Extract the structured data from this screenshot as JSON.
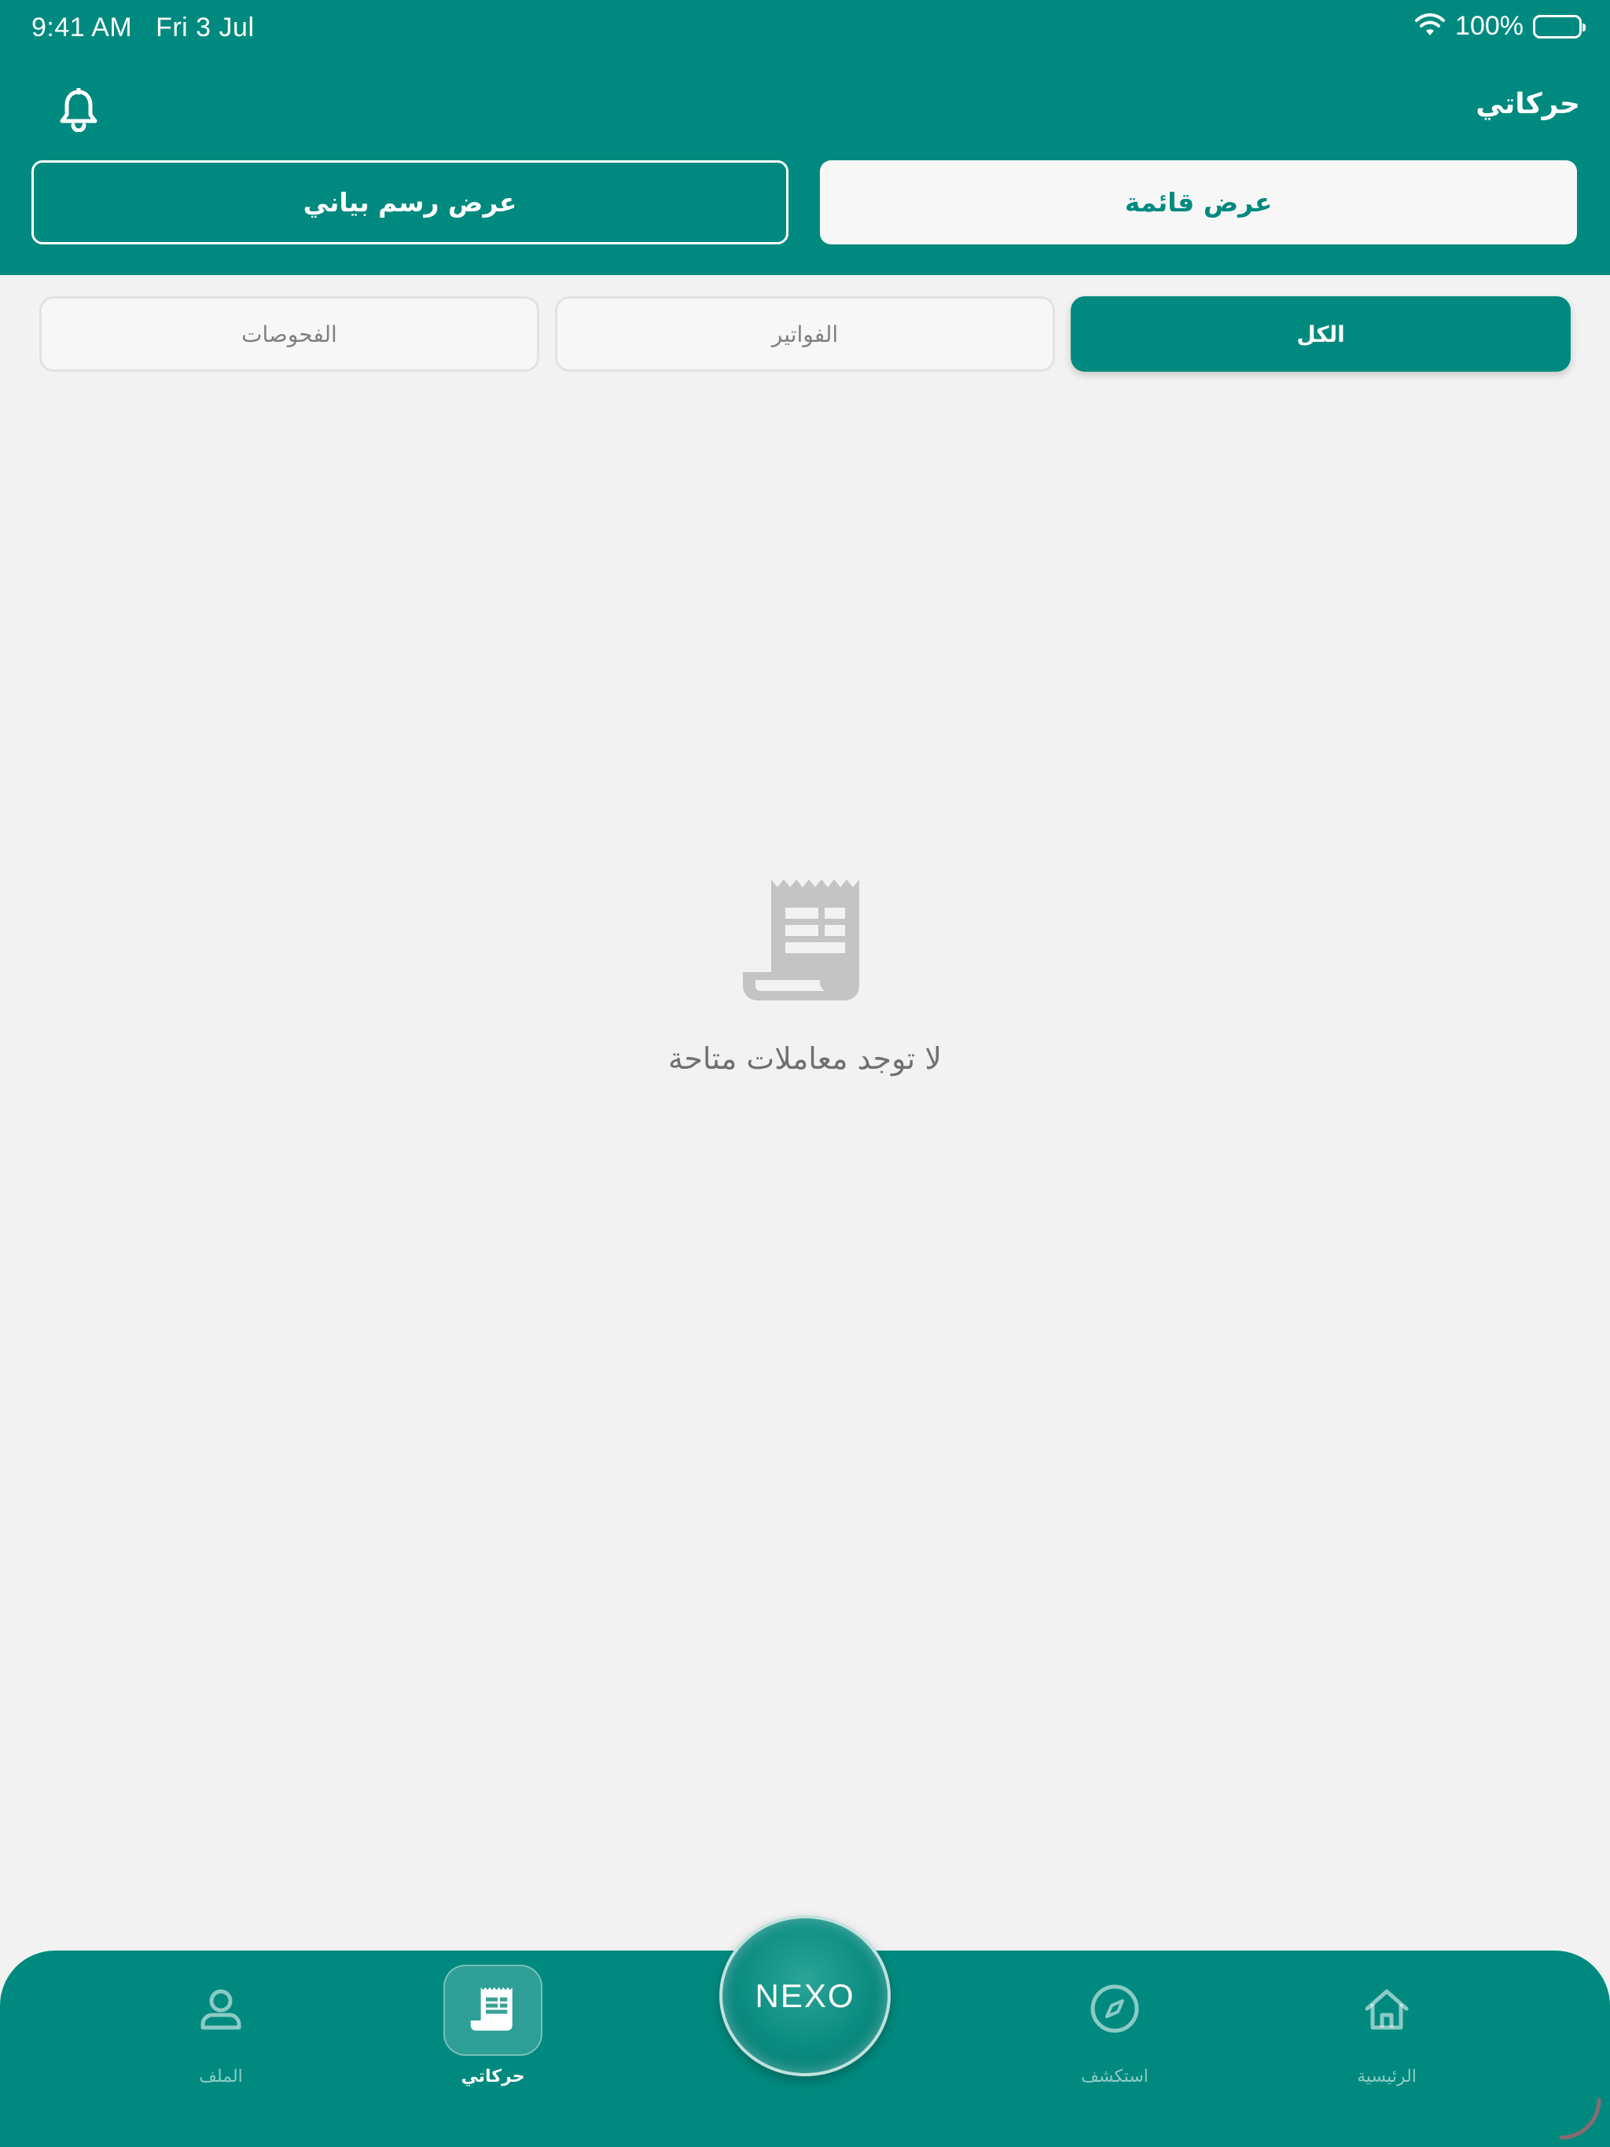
{
  "status_bar": {
    "time": "9:41 AM",
    "date": "Fri 3 Jul",
    "battery": "100%"
  },
  "header": {
    "title": "حركاتي",
    "view_list_label": "عرض قائمة",
    "view_chart_label": "عرض رسم بياني"
  },
  "filters": {
    "all": "الكل",
    "bills": "الفواتير",
    "checks": "الفحوصات"
  },
  "empty_state": {
    "message": "لا توجد معاملات متاحة"
  },
  "bottom_nav": {
    "home": "الرئيسية",
    "explore": "استكشف",
    "center": "NEXO",
    "moves": "حركاتي",
    "profile": "الملف"
  },
  "colors": {
    "primary": "#008a7f",
    "background": "#f2f2f2"
  }
}
